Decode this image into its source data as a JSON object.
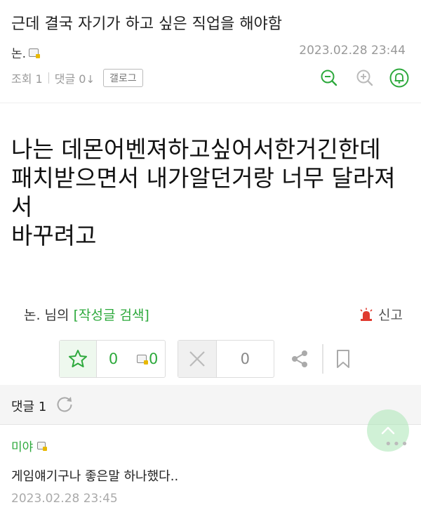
{
  "post": {
    "title": "근데 결국 자기가 하고 싶은 직업을 해야함",
    "author": "논.",
    "date": "2023.02.28 23:44",
    "views_label": "조회 1",
    "comments_label": "댓글 0",
    "gallery_label": "갤로그",
    "body_lines": [
      "나는 데몬어벤져하고싶어서한거긴한데",
      "패치받으면서 내가알던거랑 너무 달라져",
      "서",
      "바꾸려고"
    ]
  },
  "footer": {
    "author_suffix": "논. 님의",
    "search_label": "[작성글 검색]",
    "report_label": "신고"
  },
  "votes": {
    "up_count": "0",
    "fixed_count": "0",
    "down_count": "0"
  },
  "comments": {
    "header_label": "댓글 1",
    "items": [
      {
        "author": "미야",
        "text": "게임얘기구나 좋은말 하나했다..",
        "date": "2023.02.28 23:45"
      }
    ]
  },
  "colors": {
    "accent": "#2da93c",
    "report": "#e03a2f",
    "muted": "#999999"
  },
  "icons": {
    "zoom_out": "zoom-out-icon",
    "zoom_in": "zoom-in-icon",
    "notify": "bell-icon",
    "upvote": "star-icon",
    "downvote": "x-icon",
    "share": "share-icon",
    "bookmark": "bookmark-icon",
    "refresh": "refresh-icon",
    "report": "siren-icon",
    "scroll_top": "chevron-up-icon"
  }
}
